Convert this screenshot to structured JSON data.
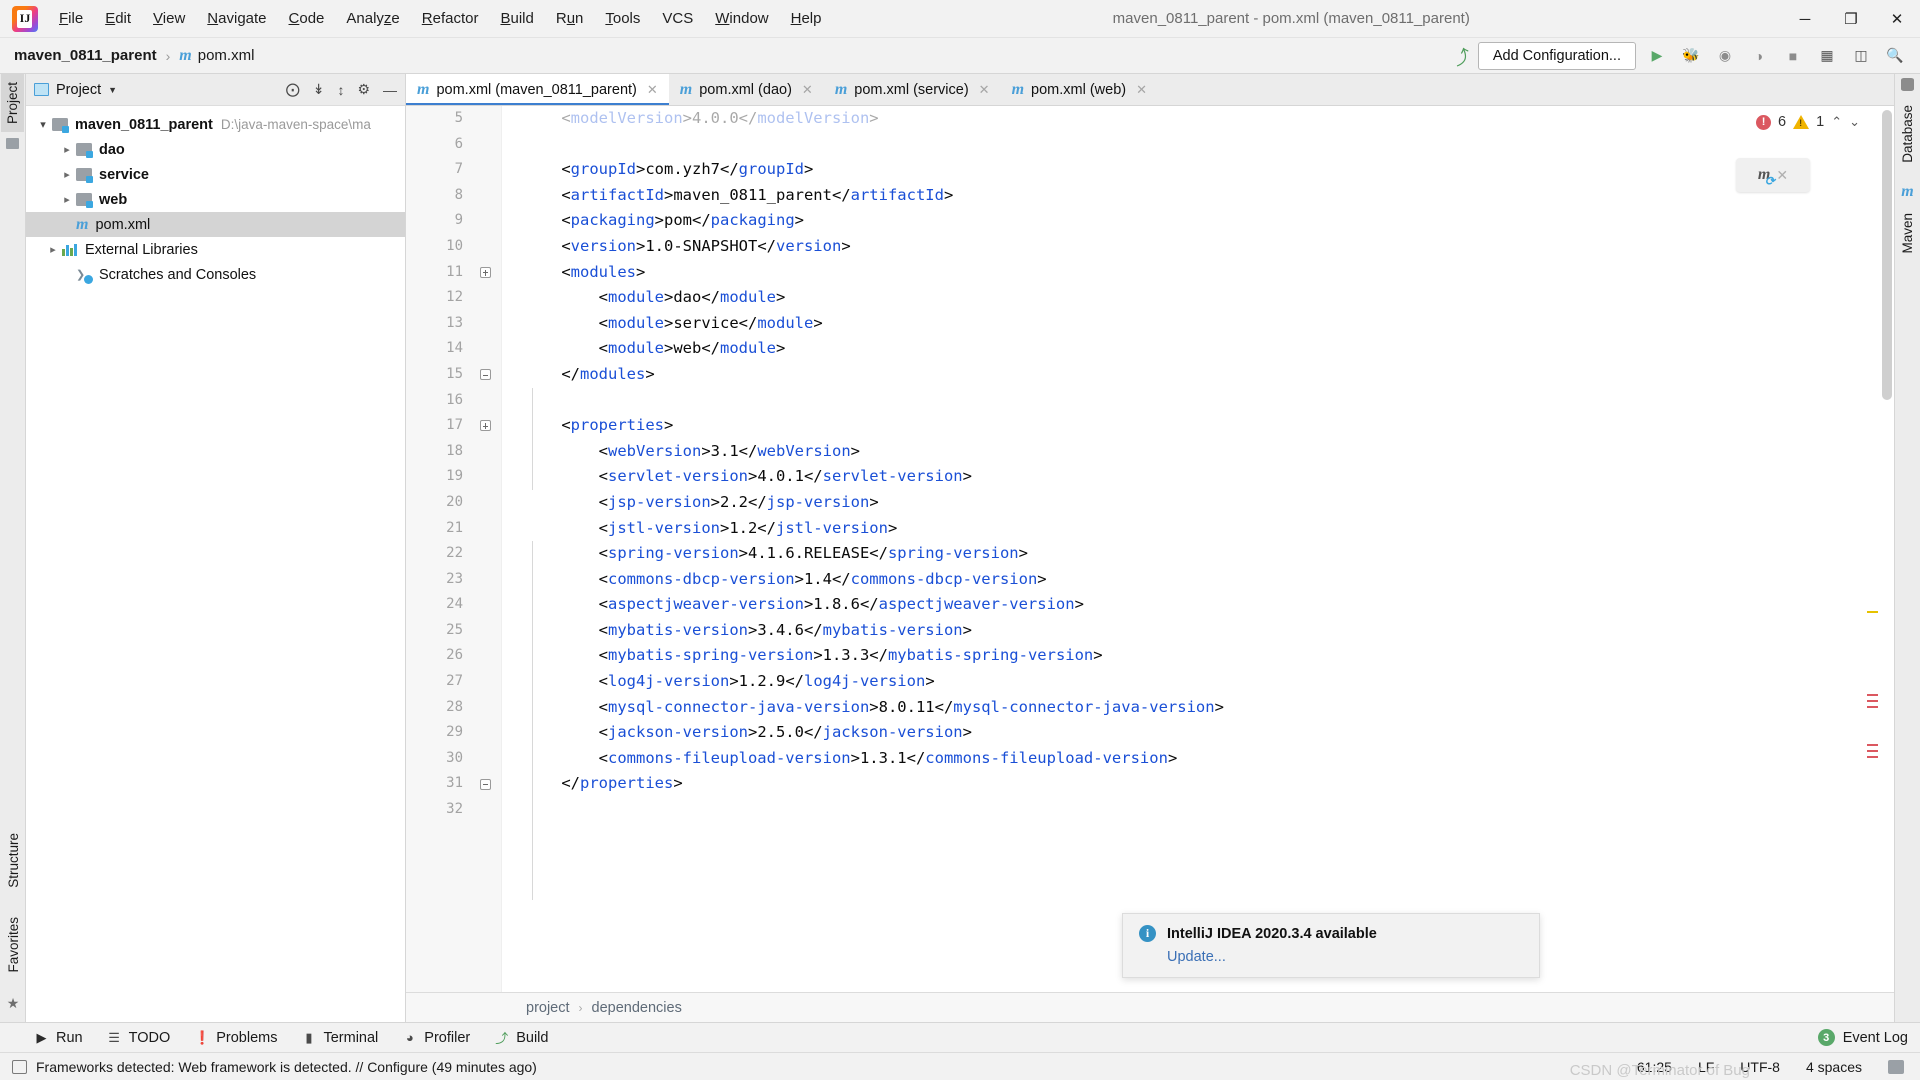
{
  "window": {
    "title": "maven_0811_parent - pom.xml (maven_0811_parent)",
    "minimize": "─",
    "maximize": "❐",
    "close": "✕"
  },
  "menu": [
    {
      "label": "File",
      "mnemonic": "F"
    },
    {
      "label": "Edit",
      "mnemonic": "E"
    },
    {
      "label": "View",
      "mnemonic": "V"
    },
    {
      "label": "Navigate",
      "mnemonic": "N"
    },
    {
      "label": "Code",
      "mnemonic": "C"
    },
    {
      "label": "Analyze",
      "mnemonic": "z"
    },
    {
      "label": "Refactor",
      "mnemonic": "R"
    },
    {
      "label": "Build",
      "mnemonic": "B"
    },
    {
      "label": "Run",
      "mnemonic": "u"
    },
    {
      "label": "Tools",
      "mnemonic": "T"
    },
    {
      "label": "VCS",
      "mnemonic": ""
    },
    {
      "label": "Window",
      "mnemonic": "W"
    },
    {
      "label": "Help",
      "mnemonic": "H"
    }
  ],
  "navbar": {
    "project": "maven_0811_parent",
    "separator": "›",
    "file": "pom.xml",
    "file_icon": "maven-m-icon",
    "add_configuration": "Add Configuration...",
    "hammer_icon": "build-hammer-icon",
    "run_icon": "run-icon",
    "debug_icon": "debug-icon",
    "coverage_icon": "coverage-icon",
    "profile_icon": "profile-icon",
    "stop_icon": "stop-icon",
    "layout_icon": "layout-icon",
    "device_icon": "device-manager-icon",
    "search_icon": "search-everywhere-icon"
  },
  "left_strip": {
    "tabs": [
      "Project",
      "Structure",
      "Favorites"
    ],
    "active": "Project"
  },
  "right_strip": {
    "tabs": [
      "Database",
      "Maven"
    ]
  },
  "project_panel": {
    "title": "Project",
    "icons": [
      "locate-icon",
      "collapse-all-icon",
      "expand-collapse-icon",
      "settings-gear-icon",
      "hide-icon"
    ],
    "tree": [
      {
        "label": "maven_0811_parent",
        "path": "D:\\java-maven-space\\ma",
        "type": "folder",
        "arrow": "open",
        "depth": 0,
        "bold": true,
        "selected": false
      },
      {
        "label": "dao",
        "path": "",
        "type": "folder",
        "arrow": "closed",
        "depth": 1,
        "bold": true,
        "selected": false
      },
      {
        "label": "service",
        "path": "",
        "type": "folder",
        "arrow": "closed",
        "depth": 1,
        "bold": true,
        "selected": false
      },
      {
        "label": "web",
        "path": "",
        "type": "folder",
        "arrow": "closed",
        "depth": 1,
        "bold": true,
        "selected": false
      },
      {
        "label": "pom.xml",
        "path": "",
        "type": "maven",
        "arrow": "none",
        "depth": 1,
        "bold": false,
        "selected": true
      },
      {
        "label": "External Libraries",
        "path": "",
        "type": "library",
        "arrow": "closed",
        "depth": 0,
        "bold": false,
        "selected": false
      },
      {
        "label": "Scratches and Consoles",
        "path": "",
        "type": "scratch",
        "arrow": "none",
        "depth": 0,
        "bold": false,
        "selected": false
      }
    ]
  },
  "editor": {
    "tabs": [
      {
        "label": "pom.xml (maven_0811_parent)",
        "active": true,
        "close": "✕"
      },
      {
        "label": "pom.xml (dao)",
        "active": false,
        "close": "✕"
      },
      {
        "label": "pom.xml (service)",
        "active": false,
        "close": "✕"
      },
      {
        "label": "pom.xml (web)",
        "active": false,
        "close": "✕"
      }
    ],
    "first_visible_line": 5,
    "lines": [
      {
        "n": 5,
        "indent": 1,
        "clipped": true,
        "tokens": [
          {
            "t": "<",
            "c": "br"
          },
          {
            "t": "modelVersion",
            "c": "tg"
          },
          {
            "t": ">4.0.0</",
            "c": "br"
          },
          {
            "t": "modelVersion",
            "c": "tg"
          },
          {
            "t": ">",
            "c": "br"
          }
        ]
      },
      {
        "n": 6,
        "indent": 0,
        "tokens": []
      },
      {
        "n": 7,
        "indent": 1,
        "tokens": [
          {
            "t": "<",
            "c": "br"
          },
          {
            "t": "groupId",
            "c": "tg"
          },
          {
            "t": ">com.yzh7</",
            "c": "br"
          },
          {
            "t": "groupId",
            "c": "tg"
          },
          {
            "t": ">",
            "c": "br"
          }
        ]
      },
      {
        "n": 8,
        "indent": 1,
        "tokens": [
          {
            "t": "<",
            "c": "br"
          },
          {
            "t": "artifactId",
            "c": "tg"
          },
          {
            "t": ">maven_0811_parent</",
            "c": "br"
          },
          {
            "t": "artifactId",
            "c": "tg"
          },
          {
            "t": ">",
            "c": "br"
          }
        ]
      },
      {
        "n": 9,
        "indent": 1,
        "tokens": [
          {
            "t": "<",
            "c": "br"
          },
          {
            "t": "packaging",
            "c": "tg"
          },
          {
            "t": ">pom</",
            "c": "br"
          },
          {
            "t": "packaging",
            "c": "tg"
          },
          {
            "t": ">",
            "c": "br"
          }
        ]
      },
      {
        "n": 10,
        "indent": 1,
        "tokens": [
          {
            "t": "<",
            "c": "br"
          },
          {
            "t": "version",
            "c": "tg"
          },
          {
            "t": ">1.0-SNAPSHOT</",
            "c": "br"
          },
          {
            "t": "version",
            "c": "tg"
          },
          {
            "t": ">",
            "c": "br"
          }
        ]
      },
      {
        "n": 11,
        "indent": 1,
        "fold": "open",
        "tokens": [
          {
            "t": "<",
            "c": "br"
          },
          {
            "t": "modules",
            "c": "tg"
          },
          {
            "t": ">",
            "c": "br"
          }
        ]
      },
      {
        "n": 12,
        "indent": 2,
        "tokens": [
          {
            "t": "<",
            "c": "br"
          },
          {
            "t": "module",
            "c": "tg"
          },
          {
            "t": ">dao</",
            "c": "br"
          },
          {
            "t": "module",
            "c": "tg"
          },
          {
            "t": ">",
            "c": "br"
          }
        ]
      },
      {
        "n": 13,
        "indent": 2,
        "tokens": [
          {
            "t": "<",
            "c": "br"
          },
          {
            "t": "module",
            "c": "tg"
          },
          {
            "t": ">service</",
            "c": "br"
          },
          {
            "t": "module",
            "c": "tg"
          },
          {
            "t": ">",
            "c": "br"
          }
        ]
      },
      {
        "n": 14,
        "indent": 2,
        "tokens": [
          {
            "t": "<",
            "c": "br"
          },
          {
            "t": "module",
            "c": "tg"
          },
          {
            "t": ">web</",
            "c": "br"
          },
          {
            "t": "module",
            "c": "tg"
          },
          {
            "t": ">",
            "c": "br"
          }
        ]
      },
      {
        "n": 15,
        "indent": 1,
        "fold": "end",
        "tokens": [
          {
            "t": "</",
            "c": "br"
          },
          {
            "t": "modules",
            "c": "tg"
          },
          {
            "t": ">",
            "c": "br"
          }
        ]
      },
      {
        "n": 16,
        "indent": 0,
        "tokens": []
      },
      {
        "n": 17,
        "indent": 1,
        "fold": "open",
        "tokens": [
          {
            "t": "<",
            "c": "br"
          },
          {
            "t": "properties",
            "c": "tg"
          },
          {
            "t": ">",
            "c": "br"
          }
        ]
      },
      {
        "n": 18,
        "indent": 2,
        "tokens": [
          {
            "t": "<",
            "c": "br"
          },
          {
            "t": "webVersion",
            "c": "tg"
          },
          {
            "t": ">3.1</",
            "c": "br"
          },
          {
            "t": "webVersion",
            "c": "tg"
          },
          {
            "t": ">",
            "c": "br"
          }
        ]
      },
      {
        "n": 19,
        "indent": 2,
        "tokens": [
          {
            "t": "<",
            "c": "br"
          },
          {
            "t": "servlet-version",
            "c": "tg"
          },
          {
            "t": ">4.0.1</",
            "c": "br"
          },
          {
            "t": "servlet-version",
            "c": "tg"
          },
          {
            "t": ">",
            "c": "br"
          }
        ]
      },
      {
        "n": 20,
        "indent": 2,
        "tokens": [
          {
            "t": "<",
            "c": "br"
          },
          {
            "t": "jsp-version",
            "c": "tg"
          },
          {
            "t": ">2.2</",
            "c": "br"
          },
          {
            "t": "jsp-version",
            "c": "tg"
          },
          {
            "t": ">",
            "c": "br"
          }
        ]
      },
      {
        "n": 21,
        "indent": 2,
        "tokens": [
          {
            "t": "<",
            "c": "br"
          },
          {
            "t": "jstl-version",
            "c": "tg"
          },
          {
            "t": ">1.2</",
            "c": "br"
          },
          {
            "t": "jstl-version",
            "c": "tg"
          },
          {
            "t": ">",
            "c": "br"
          }
        ]
      },
      {
        "n": 22,
        "indent": 2,
        "tokens": [
          {
            "t": "<",
            "c": "br"
          },
          {
            "t": "spring-version",
            "c": "tg"
          },
          {
            "t": ">4.1.6.RELEASE</",
            "c": "br"
          },
          {
            "t": "spring-version",
            "c": "tg"
          },
          {
            "t": ">",
            "c": "br"
          }
        ]
      },
      {
        "n": 23,
        "indent": 2,
        "tokens": [
          {
            "t": "<",
            "c": "br"
          },
          {
            "t": "commons-dbcp-version",
            "c": "tg"
          },
          {
            "t": ">1.4</",
            "c": "br"
          },
          {
            "t": "commons-dbcp-version",
            "c": "tg"
          },
          {
            "t": ">",
            "c": "br"
          }
        ]
      },
      {
        "n": 24,
        "indent": 2,
        "tokens": [
          {
            "t": "<",
            "c": "br"
          },
          {
            "t": "aspectjweaver-version",
            "c": "tg"
          },
          {
            "t": ">1.8.6</",
            "c": "br"
          },
          {
            "t": "aspectjweaver-version",
            "c": "tg"
          },
          {
            "t": ">",
            "c": "br"
          }
        ]
      },
      {
        "n": 25,
        "indent": 2,
        "tokens": [
          {
            "t": "<",
            "c": "br"
          },
          {
            "t": "mybatis-version",
            "c": "tg"
          },
          {
            "t": ">3.4.6</",
            "c": "br"
          },
          {
            "t": "mybatis-version",
            "c": "tg"
          },
          {
            "t": ">",
            "c": "br"
          }
        ]
      },
      {
        "n": 26,
        "indent": 2,
        "tokens": [
          {
            "t": "<",
            "c": "br"
          },
          {
            "t": "mybatis-spring-version",
            "c": "tg"
          },
          {
            "t": ">1.3.3</",
            "c": "br"
          },
          {
            "t": "mybatis-spring-version",
            "c": "tg"
          },
          {
            "t": ">",
            "c": "br"
          }
        ]
      },
      {
        "n": 27,
        "indent": 2,
        "tokens": [
          {
            "t": "<",
            "c": "br"
          },
          {
            "t": "log4j-version",
            "c": "tg"
          },
          {
            "t": ">1.2.9</",
            "c": "br"
          },
          {
            "t": "log4j-version",
            "c": "tg"
          },
          {
            "t": ">",
            "c": "br"
          }
        ]
      },
      {
        "n": 28,
        "indent": 2,
        "tokens": [
          {
            "t": "<",
            "c": "br"
          },
          {
            "t": "mysql-connector-java-version",
            "c": "tg"
          },
          {
            "t": ">8.0.11</",
            "c": "br"
          },
          {
            "t": "mysql-connector-java-version",
            "c": "tg"
          },
          {
            "t": ">",
            "c": "br"
          }
        ]
      },
      {
        "n": 29,
        "indent": 2,
        "tokens": [
          {
            "t": "<",
            "c": "br"
          },
          {
            "t": "jackson-version",
            "c": "tg"
          },
          {
            "t": ">2.5.0</",
            "c": "br"
          },
          {
            "t": "jackson-version",
            "c": "tg"
          },
          {
            "t": ">",
            "c": "br"
          }
        ]
      },
      {
        "n": 30,
        "indent": 2,
        "tokens": [
          {
            "t": "<",
            "c": "br"
          },
          {
            "t": "commons-fileupload-version",
            "c": "tg"
          },
          {
            "t": ">1.3.1</",
            "c": "br"
          },
          {
            "t": "commons-fileupload-version",
            "c": "tg"
          },
          {
            "t": ">",
            "c": "br"
          }
        ]
      },
      {
        "n": 31,
        "indent": 1,
        "fold": "end",
        "tokens": [
          {
            "t": "</",
            "c": "br"
          },
          {
            "t": "properties",
            "c": "tg"
          },
          {
            "t": ">",
            "c": "br"
          }
        ]
      },
      {
        "n": 32,
        "indent": 0,
        "tokens": []
      }
    ],
    "inspection": {
      "error_count": "6",
      "warning_count": "1",
      "error_icon": "error-icon",
      "warning_icon": "warning-icon",
      "prev": "⌃",
      "next": "⌄"
    },
    "maven_float": {
      "icon": "maven-reload-icon",
      "close": "✕"
    },
    "breadcrumb": [
      "project",
      "dependencies"
    ],
    "breadcrumb_sep": "›"
  },
  "tool_windows": [
    {
      "label": "Run",
      "icon": "play-icon"
    },
    {
      "label": "TODO",
      "icon": "list-icon"
    },
    {
      "label": "Problems",
      "icon": "problems-icon"
    },
    {
      "label": "Terminal",
      "icon": "terminal-icon"
    },
    {
      "label": "Profiler",
      "icon": "profiler-icon"
    },
    {
      "label": "Build",
      "icon": "build-hammer-icon"
    }
  ],
  "event_log": {
    "label": "Event Log",
    "count": "3"
  },
  "statusbar": {
    "message": "Frameworks detected: Web framework is detected. // Configure (49 minutes ago)",
    "icon": "notification-icon",
    "caret": "61:25",
    "line_sep": "LF",
    "encoding": "UTF-8",
    "indent": "4 spaces",
    "watermark": "CSDN @Terminator of Bug",
    "lock_icon": "read-only-icon"
  },
  "notification": {
    "icon": "info-icon",
    "title": "IntelliJ IDEA 2020.3.4 available",
    "link": "Update..."
  }
}
